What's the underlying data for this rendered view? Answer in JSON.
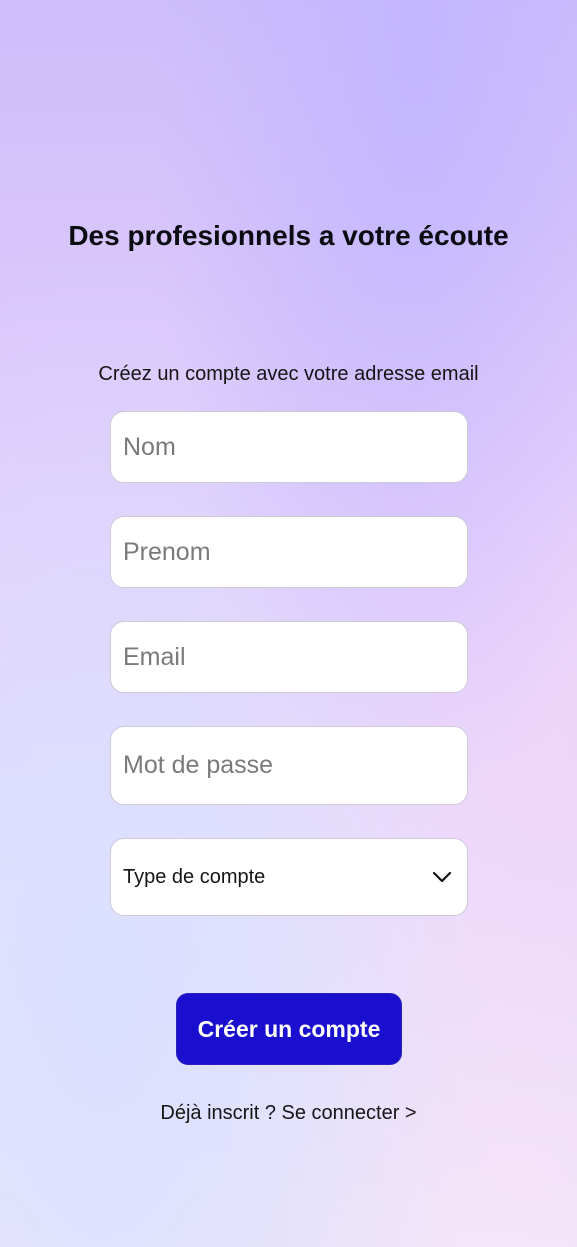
{
  "header": {
    "title": "Des profesionnels a votre écoute"
  },
  "form": {
    "subtitle": "Créez un compte avec votre adresse email",
    "fields": {
      "nom": {
        "placeholder": "Nom",
        "value": ""
      },
      "prenom": {
        "placeholder": "Prenom",
        "value": ""
      },
      "email": {
        "placeholder": "Email",
        "value": ""
      },
      "password": {
        "placeholder": "Mot de passe",
        "value": ""
      }
    },
    "account_type": {
      "selected": "Type de compte",
      "icon": "chevron-down-icon"
    },
    "submit_label": "Créer un compte",
    "login_link": "Déjà inscrit ? Se connecter >"
  },
  "colors": {
    "primary_button": "#1a0fce",
    "button_text": "#ffffff",
    "field_border": "#cfc9d9",
    "background_top": "#cdbdfb",
    "background_bottom": "#ece4fb"
  }
}
